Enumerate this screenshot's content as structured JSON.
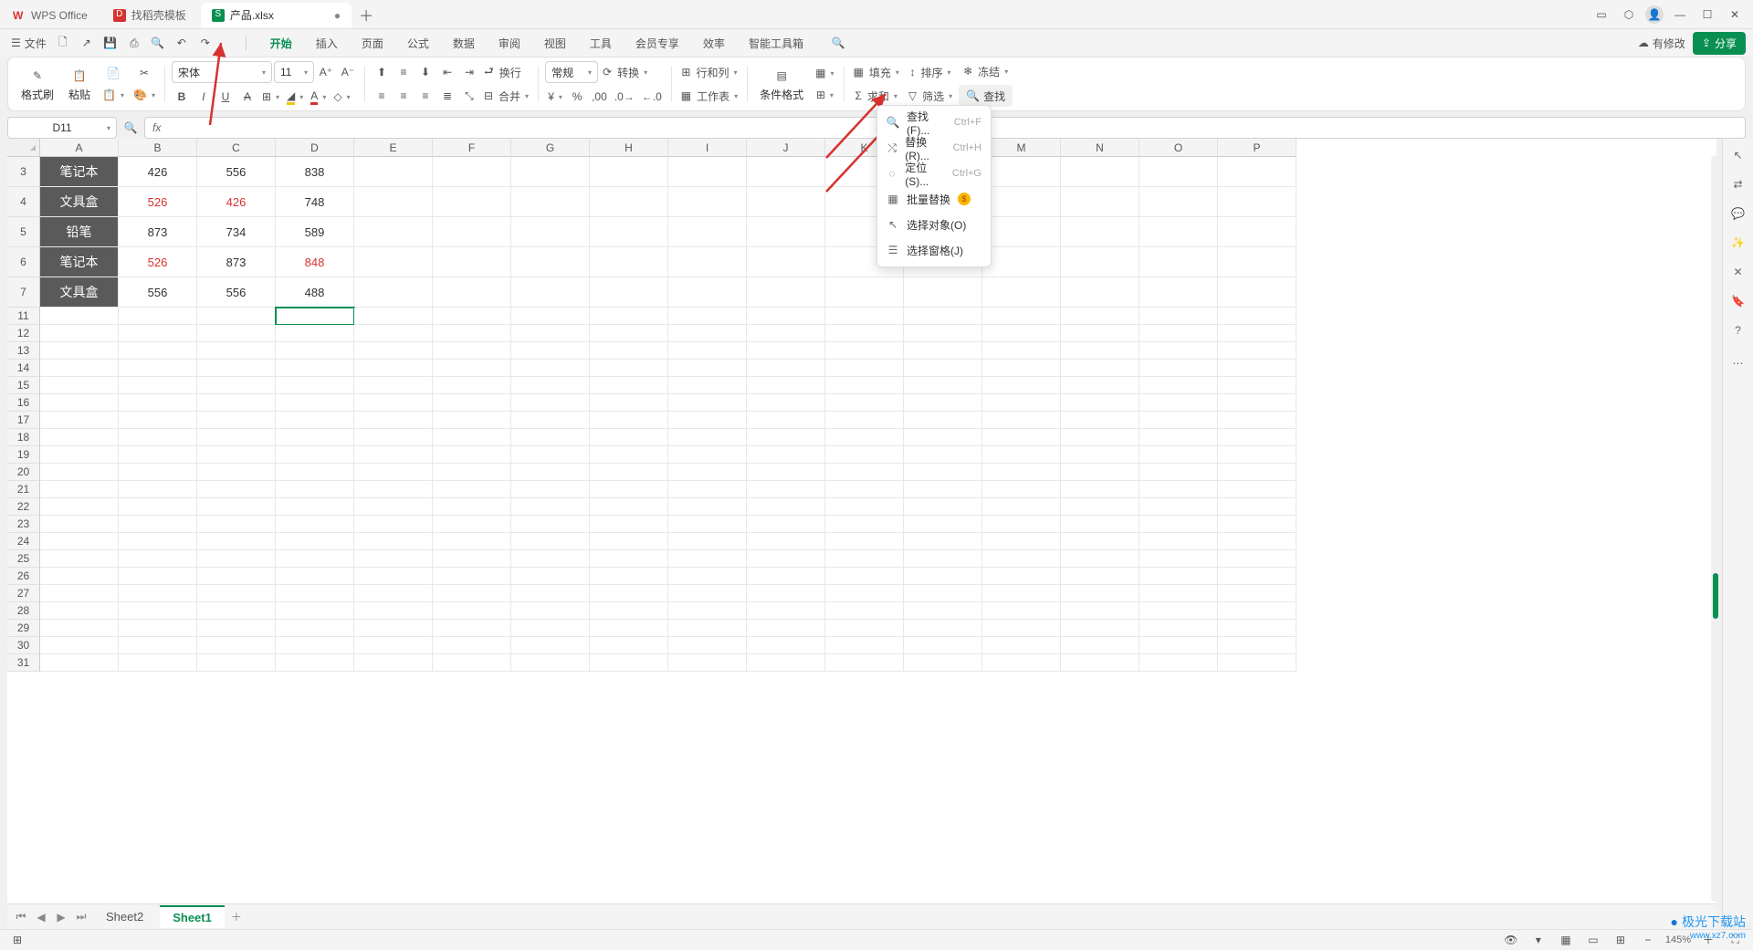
{
  "titlebar": {
    "tabs": [
      {
        "label": "WPS Office",
        "icon": "W",
        "color": "#d7322f"
      },
      {
        "label": "找稻壳模板",
        "icon": "D",
        "color": "#d7322f"
      },
      {
        "label": "产品.xlsx",
        "icon": "S",
        "color": "#0a8f52",
        "active": true,
        "dirty": "●"
      }
    ],
    "newtab": "＋"
  },
  "qat": {
    "file": "文件",
    "shareBtn": "分享",
    "changesLabel": "有修改"
  },
  "menuTabs": [
    "开始",
    "插入",
    "页面",
    "公式",
    "数据",
    "审阅",
    "视图",
    "工具",
    "会员专享",
    "效率",
    "智能工具箱"
  ],
  "activeMenuTab": "开始",
  "ribbon": {
    "formatBrush": "格式刷",
    "paste": "粘贴",
    "fontName": "宋体",
    "fontSize": "11",
    "numberGroup": "常规",
    "convert": "转换",
    "rowsCols": "行和列",
    "worksheet": "工作表",
    "condFormat": "条件格式",
    "fill": "填充",
    "sort": "排序",
    "freeze": "冻结",
    "sum": "求和",
    "filter": "筛选",
    "find": "查找",
    "wrap": "换行",
    "merge": "合并"
  },
  "findMenu": [
    {
      "icon": "🔍",
      "label": "查找(F)...",
      "shortcut": "Ctrl+F"
    },
    {
      "icon": "⤭",
      "label": "替换(R)...",
      "shortcut": "Ctrl+H"
    },
    {
      "icon": "◌",
      "label": "定位(S)...",
      "shortcut": "Ctrl+G"
    },
    {
      "icon": "▦",
      "label": "批量替换",
      "badge": "$"
    },
    {
      "icon": "↖",
      "label": "选择对象(O)"
    },
    {
      "icon": "☰",
      "label": "选择窗格(J)"
    }
  ],
  "namebox": "D11",
  "columns": [
    "A",
    "B",
    "C",
    "D",
    "E",
    "F",
    "G",
    "H",
    "I",
    "J",
    "K",
    "L",
    "M",
    "N",
    "O",
    "P"
  ],
  "visibleRowNumbers": [
    3,
    4,
    5,
    6,
    7,
    11,
    12,
    13,
    14,
    15,
    16,
    17,
    18,
    19,
    20,
    21,
    22,
    23,
    24,
    25,
    26,
    27,
    28,
    29,
    30,
    31
  ],
  "data": {
    "rowLabels": [
      "笔记本",
      "文具盒",
      "铅笔",
      "笔记本",
      "文具盒"
    ],
    "cells": [
      [
        {
          "v": "426"
        },
        {
          "v": "556"
        },
        {
          "v": "838"
        }
      ],
      [
        {
          "v": "526",
          "r": true
        },
        {
          "v": "426",
          "r": true
        },
        {
          "v": "748"
        }
      ],
      [
        {
          "v": "873"
        },
        {
          "v": "734"
        },
        {
          "v": "589"
        }
      ],
      [
        {
          "v": "526",
          "r": true
        },
        {
          "v": "873"
        },
        {
          "v": "848",
          "r": true
        }
      ],
      [
        {
          "v": "556"
        },
        {
          "v": "556"
        },
        {
          "v": "488"
        }
      ]
    ]
  },
  "activeCell": {
    "row": 11,
    "col": "D"
  },
  "sheetTabs": [
    "Sheet2",
    "Sheet1"
  ],
  "activeSheet": "Sheet1",
  "status": {
    "zoom": "145%"
  },
  "watermark": {
    "txt": "极光下载站",
    "url": "www.xz7.com"
  }
}
